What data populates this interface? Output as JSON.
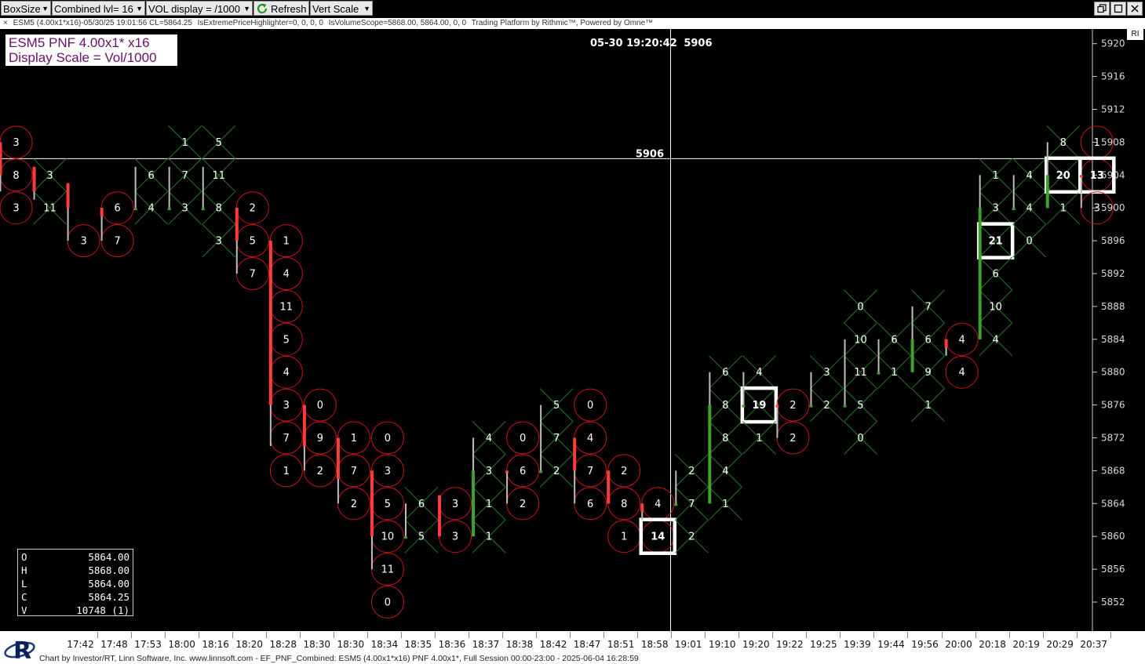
{
  "toolbar": {
    "boxsize_label": "BoxSize",
    "combined_label": "Combined lvl= 16",
    "vol_label": "VOL display = /1000",
    "refresh_label": "Refresh",
    "vertscale_label": "Vert Scale",
    "dropdown_glyph": "▼"
  },
  "statusbar": {
    "close_glyph": "×",
    "chart_info": "ESM5 (4.00x1*x16)-05/30/25 19:01:56 CL=5864.25",
    "indicator1": "IsExtremePriceHighlighter=0, 0, 0, 0",
    "indicator2": "IsVolumeScope=5868.00, 5864.00, 0, 0",
    "platform": "Trading Platform by Rithmic™, Powered by Omne™"
  },
  "chart_title": {
    "line1": "ESM5 PNF 4.00x1* x16",
    "line2": "Display Scale = Vol/1000"
  },
  "crosshair": {
    "datetime": "05-30 19:20:42",
    "price_label": "5906",
    "price_value": 5906
  },
  "ri_label": "RI",
  "ohlc": [
    {
      "key": "O",
      "value": "5864.00"
    },
    {
      "key": "H",
      "value": "5868.00"
    },
    {
      "key": "L",
      "value": "5864.00"
    },
    {
      "key": "C",
      "value": "5864.25"
    },
    {
      "key": "V",
      "value": "10748 (1)"
    }
  ],
  "footer_text": "Chart by Investor/RT, Linn Software, Inc. www.linnsoft.com - EF_PNF_Combined: ESM5 (4.00x1*x16) PNF 4.00x1*, Full Session 00:00-23:00 - 2025-06-04 16:28:59",
  "colors": {
    "background": "#000000",
    "up_bar": "#3fa22a",
    "down_bar": "#ff3b3b",
    "x_mark": "#1f7a1f",
    "o_mark": "#c81414",
    "highlight_box": "#ffffff",
    "axis": "#d0d0d0"
  },
  "chart_data": {
    "type": "point_and_figure",
    "box_size": 4,
    "y_axis": {
      "ticks": [
        5852,
        5856,
        5860,
        5864,
        5868,
        5872,
        5876,
        5880,
        5884,
        5888,
        5892,
        5896,
        5900,
        5904,
        5908,
        5912,
        5916,
        5920
      ],
      "tick_labels": [
        "5852",
        "5856",
        "5860",
        "5864",
        "5868",
        "5872",
        "5876",
        "5880",
        "5884",
        "5888",
        "5892",
        "5896",
        "5900",
        "5904",
        "5908",
        "5912",
        "5916",
        "5920"
      ],
      "range": [
        5848,
        5922
      ]
    },
    "x_axis": {
      "tick_labels": [
        "17:42",
        "17:48",
        "17:53",
        "18:00",
        "18:16",
        "18:20",
        "18:28",
        "18:30",
        "18:30",
        "18:34",
        "18:35",
        "18:36",
        "18:37",
        "18:38",
        "18:42",
        "18:47",
        "18:51",
        "18:58",
        "19:01",
        "19:10",
        "19:20",
        "19:22",
        "19:25",
        "19:39",
        "19:44",
        "19:56",
        "20:00",
        "20:18",
        "20:19",
        "20:29",
        "20:37"
      ]
    },
    "columns": [
      {
        "type": "O",
        "cells": [
          {
            "p": 5908,
            "v": "3"
          },
          {
            "p": 5904,
            "v": "8"
          },
          {
            "p": 5900,
            "v": "3"
          }
        ],
        "bar": {
          "hi": 5908,
          "lo": 5902,
          "dir": "down",
          "close": 5904
        }
      },
      {
        "type": "X",
        "cells": [
          {
            "p": 5904,
            "v": "3"
          },
          {
            "p": 5900,
            "v": "11"
          }
        ],
        "bar": {
          "hi": 5905,
          "lo": 5901,
          "dir": "down",
          "close": 5902
        }
      },
      {
        "type": "O",
        "cells": [
          {
            "p": 5896,
            "v": "3"
          }
        ],
        "bar": {
          "hi": 5903,
          "lo": 5896,
          "dir": "down",
          "close": 5900
        }
      },
      {
        "type": "O",
        "cells": [
          {
            "p": 5900,
            "v": "6"
          },
          {
            "p": 5896,
            "v": "7"
          }
        ],
        "bar": {
          "hi": 5900,
          "lo": 5896,
          "dir": "down",
          "close": 5899
        }
      },
      {
        "type": "X",
        "cells": [
          {
            "p": 5904,
            "v": "6"
          },
          {
            "p": 5900,
            "v": "4"
          }
        ],
        "bar": {
          "hi": 5905,
          "lo": 5900,
          "dir": "up",
          "close": 5900
        }
      },
      {
        "type": "X",
        "cells": [
          {
            "p": 5908,
            "v": "1"
          },
          {
            "p": 5904,
            "v": "7"
          },
          {
            "p": 5900,
            "v": "3"
          }
        ],
        "bar": {
          "hi": 5905,
          "lo": 5900,
          "dir": "up",
          "close": 5900
        }
      },
      {
        "type": "X",
        "cells": [
          {
            "p": 5908,
            "v": "5"
          },
          {
            "p": 5904,
            "v": "11"
          },
          {
            "p": 5900,
            "v": "8"
          },
          {
            "p": 5896,
            "v": "3"
          }
        ],
        "bar": {
          "hi": 5905,
          "lo": 5900,
          "dir": "up",
          "close": 5900
        }
      },
      {
        "type": "O",
        "cells": [
          {
            "p": 5900,
            "v": "2"
          },
          {
            "p": 5896,
            "v": "5"
          },
          {
            "p": 5892,
            "v": "7"
          }
        ],
        "bar": {
          "hi": 5900,
          "lo": 5892,
          "dir": "down",
          "close": 5896
        }
      },
      {
        "type": "O",
        "cells": [
          {
            "p": 5896,
            "v": "1"
          },
          {
            "p": 5892,
            "v": "4"
          },
          {
            "p": 5888,
            "v": "11"
          },
          {
            "p": 5884,
            "v": "5"
          },
          {
            "p": 5880,
            "v": "4"
          },
          {
            "p": 5876,
            "v": "3"
          },
          {
            "p": 5872,
            "v": "7"
          },
          {
            "p": 5868,
            "v": "1"
          }
        ],
        "bar": {
          "hi": 5896,
          "lo": 5871,
          "dir": "down",
          "close": 5876
        }
      },
      {
        "type": "O",
        "cells": [
          {
            "p": 5876,
            "v": "0"
          },
          {
            "p": 5872,
            "v": "9"
          },
          {
            "p": 5868,
            "v": "2"
          }
        ],
        "bar": {
          "hi": 5876,
          "lo": 5868,
          "dir": "down",
          "close": 5871
        }
      },
      {
        "type": "O",
        "cells": [
          {
            "p": 5872,
            "v": "1"
          },
          {
            "p": 5868,
            "v": "7"
          },
          {
            "p": 5864,
            "v": "2"
          }
        ],
        "bar": {
          "hi": 5872,
          "lo": 5864,
          "dir": "down",
          "close": 5867
        }
      },
      {
        "type": "O",
        "cells": [
          {
            "p": 5872,
            "v": "0"
          },
          {
            "p": 5868,
            "v": "3"
          },
          {
            "p": 5864,
            "v": "5"
          },
          {
            "p": 5860,
            "v": "10"
          },
          {
            "p": 5856,
            "v": "11"
          },
          {
            "p": 5852,
            "v": "0"
          }
        ],
        "bar": {
          "hi": 5868,
          "lo": 5856,
          "dir": "down",
          "close": 5860
        }
      },
      {
        "type": "X",
        "cells": [
          {
            "p": 5864,
            "v": "6"
          },
          {
            "p": 5860,
            "v": "5"
          }
        ],
        "bar": {
          "hi": 5864,
          "lo": 5860,
          "dir": "up",
          "close": 5860
        }
      },
      {
        "type": "O",
        "cells": [
          {
            "p": 5864,
            "v": "3"
          },
          {
            "p": 5860,
            "v": "3"
          }
        ],
        "bar": {
          "hi": 5865,
          "lo": 5860,
          "dir": "down",
          "close": 5860
        }
      },
      {
        "type": "X",
        "cells": [
          {
            "p": 5872,
            "v": "4"
          },
          {
            "p": 5868,
            "v": "3"
          },
          {
            "p": 5864,
            "v": "1"
          },
          {
            "p": 5860,
            "v": "1"
          }
        ],
        "bar": {
          "hi": 5872,
          "lo": 5860,
          "dir": "up",
          "close": 5868
        }
      },
      {
        "type": "O",
        "cells": [
          {
            "p": 5872,
            "v": "0"
          },
          {
            "p": 5868,
            "v": "6"
          },
          {
            "p": 5864,
            "v": "2"
          }
        ],
        "bar": {
          "hi": 5868,
          "lo": 5864,
          "dir": "down",
          "close": 5868
        }
      },
      {
        "type": "X",
        "cells": [
          {
            "p": 5876,
            "v": "5"
          },
          {
            "p": 5872,
            "v": "7"
          },
          {
            "p": 5868,
            "v": "2"
          }
        ],
        "bar": {
          "hi": 5876,
          "lo": 5868,
          "dir": "up",
          "close": 5868
        }
      },
      {
        "type": "O",
        "cells": [
          {
            "p": 5876,
            "v": "0"
          },
          {
            "p": 5872,
            "v": "4"
          },
          {
            "p": 5868,
            "v": "7"
          },
          {
            "p": 5864,
            "v": "6"
          }
        ],
        "bar": {
          "hi": 5872,
          "lo": 5864,
          "dir": "down",
          "close": 5868
        }
      },
      {
        "type": "O",
        "cells": [
          {
            "p": 5868,
            "v": "2"
          },
          {
            "p": 5864,
            "v": "8"
          },
          {
            "p": 5860,
            "v": "1"
          }
        ],
        "bar": {
          "hi": 5868,
          "lo": 5864,
          "dir": "down",
          "close": 5864
        }
      },
      {
        "type": "O",
        "cells": [
          {
            "p": 5864,
            "v": "4"
          },
          {
            "p": 5860,
            "v": "14",
            "box": true
          }
        ],
        "bar": {
          "hi": 5864,
          "lo": 5862,
          "dir": "down",
          "close": 5863
        }
      },
      {
        "type": "X",
        "cells": [
          {
            "p": 5868,
            "v": "2"
          },
          {
            "p": 5864,
            "v": "7"
          },
          {
            "p": 5860,
            "v": "2"
          }
        ],
        "bar": {
          "hi": 5868,
          "lo": 5864,
          "dir": "up",
          "close": 5864
        }
      },
      {
        "type": "X",
        "cells": [
          {
            "p": 5880,
            "v": "6"
          },
          {
            "p": 5876,
            "v": "8"
          },
          {
            "p": 5872,
            "v": "8"
          },
          {
            "p": 5868,
            "v": "4"
          },
          {
            "p": 5864,
            "v": "1"
          }
        ],
        "bar": {
          "hi": 5880,
          "lo": 5864,
          "dir": "up",
          "close": 5876
        }
      },
      {
        "type": "X",
        "cells": [
          {
            "p": 5880,
            "v": "4"
          },
          {
            "p": 5876,
            "v": "19",
            "box": true
          },
          {
            "p": 5872,
            "v": "1"
          }
        ],
        "bar": {
          "hi": 5880,
          "lo": 5876,
          "dir": "up",
          "close": 5876
        }
      },
      {
        "type": "O",
        "cells": [
          {
            "p": 5876,
            "v": "2"
          },
          {
            "p": 5872,
            "v": "2"
          }
        ],
        "bar": {
          "hi": 5876,
          "lo": 5872,
          "dir": "down",
          "close": 5876
        }
      },
      {
        "type": "X",
        "cells": [
          {
            "p": 5880,
            "v": "3"
          },
          {
            "p": 5876,
            "v": "2"
          }
        ],
        "bar": {
          "hi": 5880,
          "lo": 5876,
          "dir": "up",
          "close": 5876
        }
      },
      {
        "type": "X",
        "cells": [
          {
            "p": 5888,
            "v": "0"
          },
          {
            "p": 5884,
            "v": "10"
          },
          {
            "p": 5880,
            "v": "11"
          },
          {
            "p": 5876,
            "v": "5"
          },
          {
            "p": 5872,
            "v": "0"
          }
        ],
        "bar": {
          "hi": 5884,
          "lo": 5876,
          "dir": "up",
          "close": 5876
        }
      },
      {
        "type": "X",
        "cells": [
          {
            "p": 5884,
            "v": "6"
          },
          {
            "p": 5880,
            "v": "1"
          }
        ],
        "bar": {
          "hi": 5884,
          "lo": 5880,
          "dir": "up",
          "close": 5880
        }
      },
      {
        "type": "X",
        "cells": [
          {
            "p": 5888,
            "v": "7"
          },
          {
            "p": 5884,
            "v": "6"
          },
          {
            "p": 5880,
            "v": "9"
          },
          {
            "p": 5876,
            "v": "1"
          }
        ],
        "bar": {
          "hi": 5888,
          "lo": 5880,
          "dir": "up",
          "close": 5884
        }
      },
      {
        "type": "O",
        "cells": [
          {
            "p": 5884,
            "v": "4"
          },
          {
            "p": 5880,
            "v": "4"
          }
        ],
        "bar": {
          "hi": 5884,
          "lo": 5882,
          "dir": "down",
          "close": 5883
        }
      },
      {
        "type": "X",
        "cells": [
          {
            "p": 5904,
            "v": "1"
          },
          {
            "p": 5900,
            "v": "3"
          },
          {
            "p": 5896,
            "v": "21",
            "box": true
          },
          {
            "p": 5892,
            "v": "6"
          },
          {
            "p": 5888,
            "v": "10"
          },
          {
            "p": 5884,
            "v": "4"
          }
        ],
        "bar": {
          "hi": 5904,
          "lo": 5884,
          "dir": "up",
          "close": 5900
        }
      },
      {
        "type": "X",
        "cells": [
          {
            "p": 5904,
            "v": "4"
          },
          {
            "p": 5900,
            "v": "4"
          },
          {
            "p": 5896,
            "v": "0"
          }
        ],
        "bar": {
          "hi": 5904,
          "lo": 5900,
          "dir": "up",
          "close": 5900
        }
      },
      {
        "type": "X",
        "cells": [
          {
            "p": 5908,
            "v": "8"
          },
          {
            "p": 5904,
            "v": "20",
            "box": true
          },
          {
            "p": 5900,
            "v": "1"
          }
        ],
        "bar": {
          "hi": 5908,
          "lo": 5900,
          "dir": "up",
          "close": 5904
        }
      },
      {
        "type": "O",
        "cells": [
          {
            "p": 5908,
            "v": "1"
          },
          {
            "p": 5904,
            "v": "13",
            "box": true
          },
          {
            "p": 5900,
            "v": "3"
          }
        ],
        "bar": {
          "hi": 5904,
          "lo": 5900,
          "dir": "down",
          "close": 5904
        }
      }
    ]
  }
}
